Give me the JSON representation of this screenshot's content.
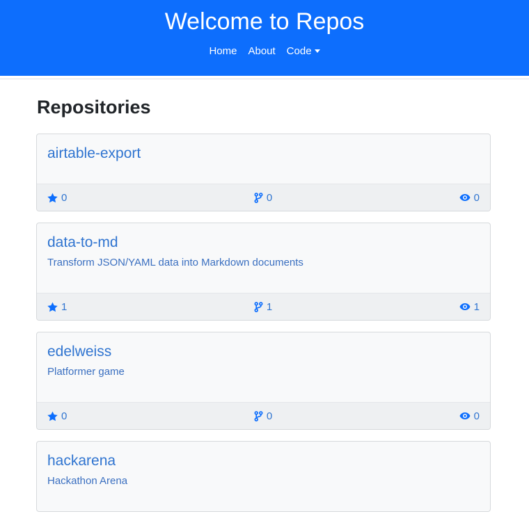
{
  "header": {
    "title": "Welcome to Repos",
    "nav": {
      "home": "Home",
      "about": "About",
      "code": "Code"
    }
  },
  "main": {
    "heading": "Repositories",
    "repos": [
      {
        "name": "airtable-export",
        "description": "",
        "stars": "0",
        "forks": "0",
        "watchers": "0"
      },
      {
        "name": "data-to-md",
        "description": "Transform JSON/YAML data into Markdown documents",
        "stars": "1",
        "forks": "1",
        "watchers": "1"
      },
      {
        "name": "edelweiss",
        "description": "Platformer game",
        "stars": "0",
        "forks": "0",
        "watchers": "0"
      },
      {
        "name": "hackarena",
        "description": "Hackathon Arena",
        "stars": "",
        "forks": "",
        "watchers": ""
      }
    ]
  },
  "colors": {
    "brand": "#0d6efd",
    "link": "#2f74d0"
  },
  "icons": {
    "stars": "star-icon",
    "forks": "fork-icon",
    "watchers": "eye-icon",
    "dropdown": "caret-down-icon"
  }
}
